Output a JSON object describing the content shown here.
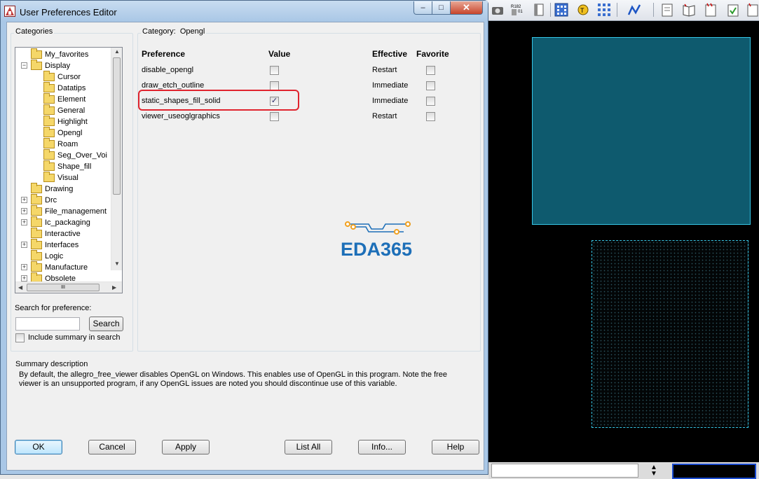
{
  "dialog": {
    "title": "User Preferences Editor",
    "window_controls": {
      "minimize": "–",
      "maximize": "□",
      "close": "✕"
    }
  },
  "categories": {
    "label": "Categories",
    "items": [
      {
        "label": "My_favorites",
        "depth": 0,
        "expander": ""
      },
      {
        "label": "Display",
        "depth": 0,
        "expander": "−"
      },
      {
        "label": "Cursor",
        "depth": 1,
        "expander": ""
      },
      {
        "label": "Datatips",
        "depth": 1,
        "expander": ""
      },
      {
        "label": "Element",
        "depth": 1,
        "expander": ""
      },
      {
        "label": "General",
        "depth": 1,
        "expander": ""
      },
      {
        "label": "Highlight",
        "depth": 1,
        "expander": ""
      },
      {
        "label": "Opengl",
        "depth": 1,
        "expander": ""
      },
      {
        "label": "Roam",
        "depth": 1,
        "expander": ""
      },
      {
        "label": "Seg_Over_Voi",
        "depth": 1,
        "expander": ""
      },
      {
        "label": "Shape_fill",
        "depth": 1,
        "expander": ""
      },
      {
        "label": "Visual",
        "depth": 1,
        "expander": ""
      },
      {
        "label": "Drawing",
        "depth": 0,
        "expander": ""
      },
      {
        "label": "Drc",
        "depth": 0,
        "expander": "+"
      },
      {
        "label": "File_management",
        "depth": 0,
        "expander": "+"
      },
      {
        "label": "Ic_packaging",
        "depth": 0,
        "expander": "+"
      },
      {
        "label": "Interactive",
        "depth": 0,
        "expander": ""
      },
      {
        "label": "Interfaces",
        "depth": 0,
        "expander": "+"
      },
      {
        "label": "Logic",
        "depth": 0,
        "expander": ""
      },
      {
        "label": "Manufacture",
        "depth": 0,
        "expander": "+"
      },
      {
        "label": "Obsolete",
        "depth": 0,
        "expander": "+"
      }
    ],
    "hscroll_thumb": "III"
  },
  "category_panel": {
    "label": "Category:",
    "value": "Opengl",
    "columns": {
      "preference": "Preference",
      "value": "Value",
      "effective": "Effective",
      "favorite": "Favorite"
    },
    "rows": [
      {
        "name": "disable_opengl",
        "value_checked": false,
        "effective": "Restart",
        "favorite": false
      },
      {
        "name": "draw_etch_outline",
        "value_checked": false,
        "effective": "Immediate",
        "favorite": false
      },
      {
        "name": "static_shapes_fill_solid",
        "value_checked": true,
        "effective": "Immediate",
        "favorite": false
      },
      {
        "name": "viewer_useoglgraphics",
        "value_checked": false,
        "effective": "Restart",
        "favorite": false
      }
    ],
    "highlighted_row": "static_shapes_fill_solid"
  },
  "logo": {
    "text": "EDA365",
    "color": "#1d6fb8",
    "accent": "#f0a020"
  },
  "search": {
    "label": "Search for preference:",
    "value": "",
    "button": "Search",
    "include_summary_label": "Include summary in search",
    "include_summary_checked": false
  },
  "summary": {
    "label": "Summary description",
    "text": "By default, the allegro_free_viewer disables OpenGL on Windows. This enables use of OpenGL in this program. Note the free viewer is an unsupported program, if any OpenGL issues are noted you should discontinue use of this variable."
  },
  "buttons": {
    "ok": "OK",
    "cancel": "Cancel",
    "apply": "Apply",
    "list_all": "List All",
    "info": "Info...",
    "help": "Help"
  },
  "background_app": {
    "toolbar_icons": [
      "camera-icon",
      "layers-icon",
      "document-icon",
      "grid-icon",
      "target-icon",
      "matrix-icon",
      "route-icon",
      "page-icon",
      "book-icon",
      "notes-icon",
      "check-icon",
      "copy-icon"
    ],
    "canvas_bg": "#000000",
    "shape_fill": "#0e5a6e",
    "shape_outline": "#36c6e6"
  }
}
